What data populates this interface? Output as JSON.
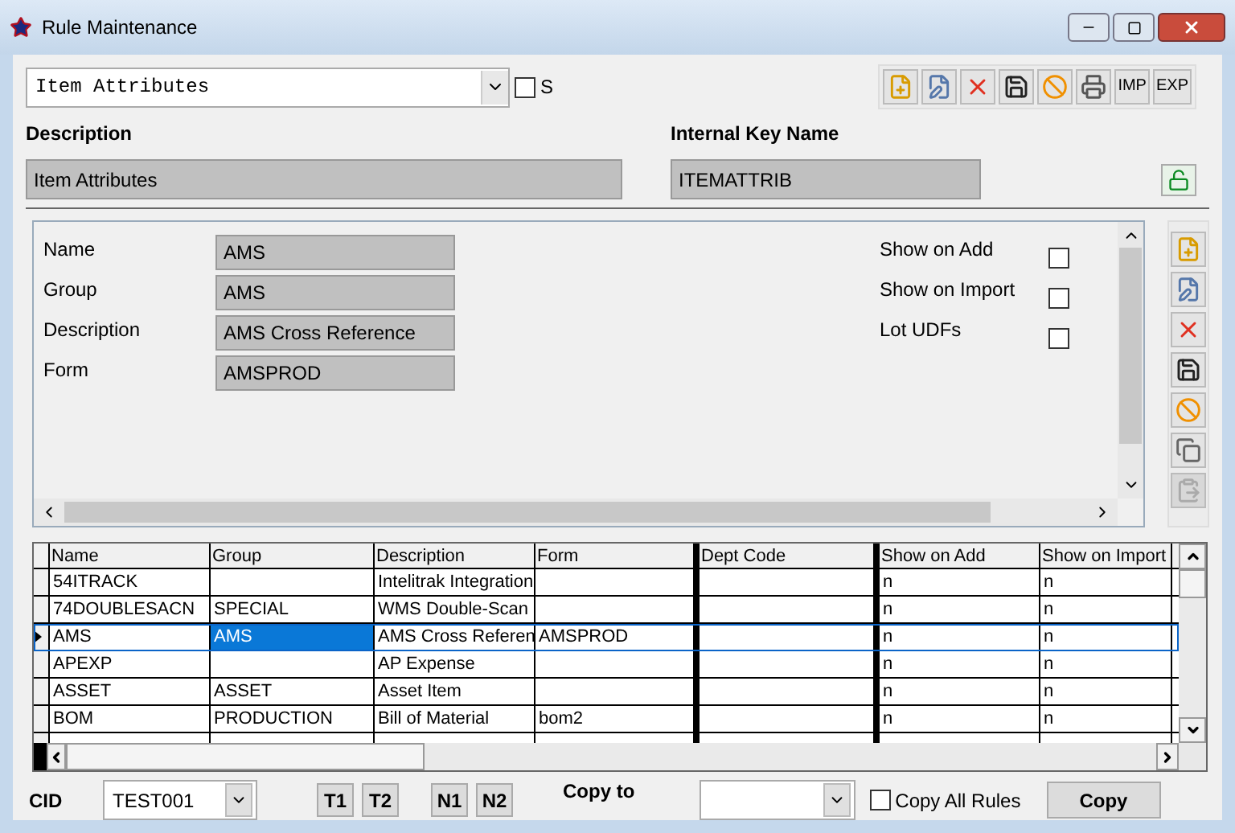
{
  "window": {
    "title": "Rule Maintenance"
  },
  "rule_select": {
    "value": "Item Attributes"
  },
  "s_checkbox": {
    "label": "S",
    "checked": false
  },
  "toolbar_text_buttons": [
    "IMP",
    "EXP"
  ],
  "description": {
    "label": "Description",
    "value": "Item Attributes"
  },
  "internal_key": {
    "label": "Internal Key Name",
    "value": "ITEMATTRIB"
  },
  "lock": {
    "locked": false
  },
  "detail_fields": [
    {
      "label": "Name",
      "value": "AMS"
    },
    {
      "label": "Group",
      "value": "AMS"
    },
    {
      "label": "Description",
      "value": "AMS Cross Reference"
    },
    {
      "label": "Form",
      "value": "AMSPROD"
    }
  ],
  "detail_flags": [
    {
      "label": "Show on Add",
      "checked": false
    },
    {
      "label": "Show on Import",
      "checked": false
    },
    {
      "label": "Lot UDFs",
      "checked": false
    }
  ],
  "side_toolbar": [
    {
      "disabled": false
    },
    {
      "disabled": false
    },
    {
      "disabled": false
    },
    {
      "disabled": false
    },
    {
      "disabled": false
    },
    {
      "disabled": false
    },
    {
      "disabled": true
    }
  ],
  "grid": {
    "columns": [
      "Name",
      "Group",
      "Description",
      "Form",
      "Dept Code",
      "Show on Add",
      "Show on Import"
    ],
    "rows": [
      {
        "selected": false,
        "cells": [
          "54ITRACK",
          "",
          "Intelitrak Integration",
          "",
          "",
          "n",
          "n"
        ]
      },
      {
        "selected": false,
        "cells": [
          "74DOUBLESACN",
          "SPECIAL",
          "WMS Double-Scan",
          "",
          "",
          "n",
          "n"
        ]
      },
      {
        "selected": true,
        "cells": [
          "AMS",
          "AMS",
          "AMS Cross Referen",
          "AMSPROD",
          "",
          "n",
          "n"
        ]
      },
      {
        "selected": false,
        "cells": [
          "APEXP",
          "",
          "AP Expense",
          "",
          "",
          "n",
          "n"
        ]
      },
      {
        "selected": false,
        "cells": [
          "ASSET",
          "ASSET",
          "Asset Item",
          "",
          "",
          "n",
          "n"
        ]
      },
      {
        "selected": false,
        "cells": [
          "BOM",
          "PRODUCTION",
          "Bill of Material",
          "bom2",
          "",
          "n",
          "n"
        ]
      }
    ]
  },
  "cid": {
    "label": "CID",
    "value": "TEST001"
  },
  "template_buttons": [
    "T1",
    "T2",
    "N1",
    "N2"
  ],
  "copy_to": {
    "label": "Copy to"
  },
  "copy_all": {
    "label": "Copy All Rules",
    "checked": false
  },
  "copy_button": "Copy"
}
